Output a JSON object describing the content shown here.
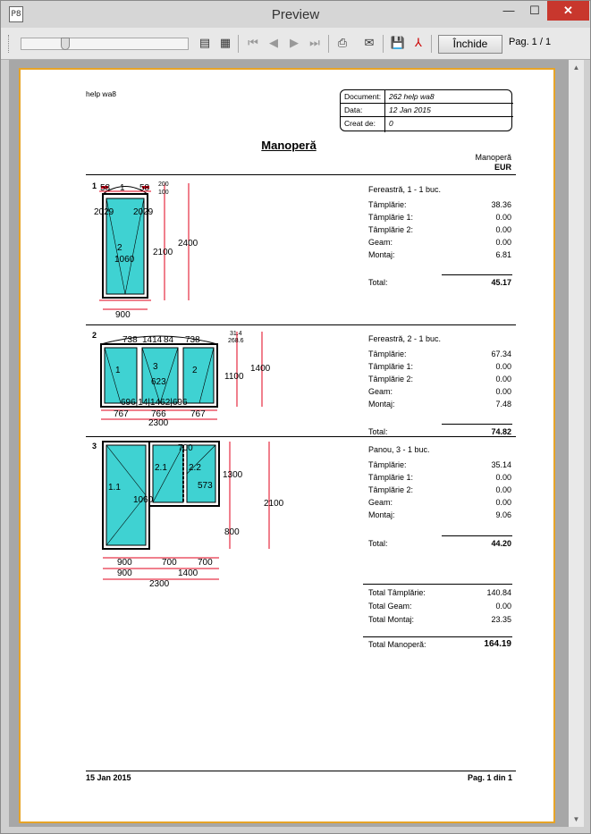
{
  "window": {
    "title": "Preview",
    "icon_text": "P8",
    "minimize_glyph": "—",
    "maximize_glyph": "☐",
    "close_glyph": "✕"
  },
  "toolbar": {
    "close_label": "Închide",
    "page_indicator": "Pag. 1 / 1",
    "zoom_level": 0.27,
    "icons": [
      "page-width-icon",
      "whole-page-icon",
      "first-page-icon",
      "prev-page-icon",
      "next-page-icon",
      "last-page-icon",
      "print-icon",
      "email-icon",
      "save-icon",
      "pdf-icon"
    ]
  },
  "report": {
    "header_left": "help wa8",
    "info": [
      {
        "label": "Document:",
        "value": "262 help wa8"
      },
      {
        "label": "Data:",
        "value": "12 Jan 2015"
      },
      {
        "label": "Creat de:",
        "value": "0"
      }
    ],
    "heading": "Manoperă",
    "col_header": "Manoperă",
    "currency": "EUR",
    "items": [
      {
        "number": "1",
        "title": "Fereastră, 1 - 1 buc.",
        "lines": [
          {
            "label": "Tâmplărie:",
            "value": "38.36"
          },
          {
            "label": "Tâmplărie 1:",
            "value": "0.00"
          },
          {
            "label": "Tâmplărie 2:",
            "value": "0.00"
          },
          {
            "label": "Geam:",
            "value": "0.00"
          },
          {
            "label": "Montaj:",
            "value": "6.81"
          }
        ],
        "total_label": "Total:",
        "total": "45.17",
        "dims": {
          "w1": "58",
          "w2": "1",
          "w3": "58",
          "top1": "200",
          "top2": "100",
          "s1": "2029",
          "s2": "2029",
          "sash": "2",
          "h_inner": "1060",
          "h1": "2100",
          "h2": "2400",
          "width": "900"
        }
      },
      {
        "number": "2",
        "title": "Fereastră, 2 - 1 buc.",
        "lines": [
          {
            "label": "Tâmplărie:",
            "value": "67.34"
          },
          {
            "label": "Tâmplărie 1:",
            "value": "0.00"
          },
          {
            "label": "Tâmplărie 2:",
            "value": "0.00"
          },
          {
            "label": "Geam:",
            "value": "0.00"
          },
          {
            "label": "Montaj:",
            "value": "7.48"
          }
        ],
        "total_label": "Total:",
        "total": "74.82",
        "dims": {
          "a": "738",
          "b": "1414",
          "c": "84",
          "d": "738",
          "arc1": "31.4",
          "arc2": "268.6",
          "s1": "1",
          "s2": "3",
          "s3": "2",
          "inner": "623",
          "bot": "696|14|1462|696",
          "h1": "1100",
          "h2": "1400",
          "w1": "767",
          "w2": "766",
          "w3": "767",
          "width": "2300"
        }
      },
      {
        "number": "3",
        "title": "Panou, 3 - 1 buc.",
        "lines": [
          {
            "label": "Tâmplărie:",
            "value": "35.14"
          },
          {
            "label": "Tâmplărie 1:",
            "value": "0.00"
          },
          {
            "label": "Tâmplărie 2:",
            "value": "0.00"
          },
          {
            "label": "Geam:",
            "value": "0.00"
          },
          {
            "label": "Montaj:",
            "value": "9.06"
          }
        ],
        "total_label": "Total:",
        "total": "44.20",
        "dims": {
          "top": "700",
          "s1": "1.1",
          "s2": "2.1",
          "s3": "2.2",
          "inner1": "1060",
          "inner2": "573",
          "h1": "1300",
          "h2": "800",
          "h3": "2100",
          "w1": "900",
          "w2": "700",
          "w3": "700",
          "w4": "900",
          "w5": "1400",
          "width": "2300"
        }
      }
    ],
    "summary": [
      {
        "label": "Total Tâmplărie:",
        "value": "140.84"
      },
      {
        "label": "Total Geam:",
        "value": "0.00"
      },
      {
        "label": "Total Montaj:",
        "value": "23.35"
      }
    ],
    "grand_label": "Total Manoperă:",
    "grand_total": "164.19",
    "footer_date": "15 Jan 2015",
    "footer_page": "Pag. 1 din 1"
  },
  "colors": {
    "glass": "#3fd2d2",
    "dim": "#e0001b",
    "page_border": "#e7a427",
    "close_button": "#c8372d"
  }
}
